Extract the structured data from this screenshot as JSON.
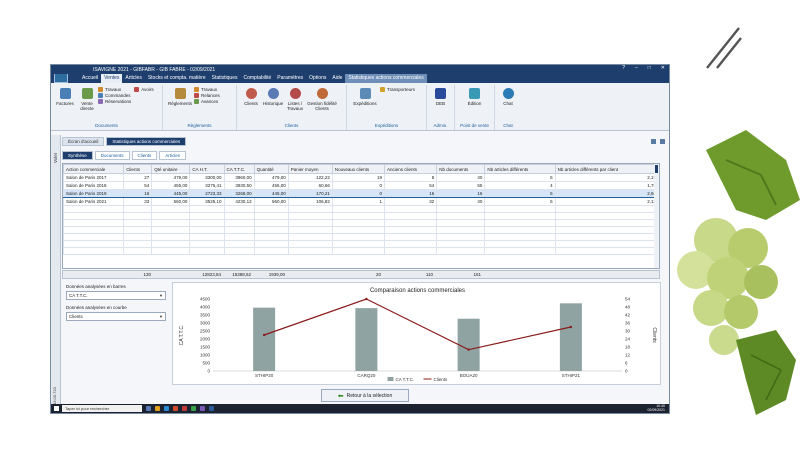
{
  "window": {
    "title": "ISAVIGNE 2021 - GIBFABR - GIB FABRE - 02/09/2021",
    "controls": [
      "?",
      "–",
      "□",
      "✕"
    ]
  },
  "menu": [
    "Accueil",
    "Ventes",
    "Articles",
    "Stocks et compta. matière",
    "Statistiques",
    "Comptabilité",
    "Paramètres",
    "Options",
    "Aide",
    "Statistiques actions commerciales"
  ],
  "ribbon": {
    "documents": {
      "factures": "Factures",
      "vente_directe": "Vente directe",
      "travaux": "Travaux",
      "commandes": "Commandes",
      "reservations": "Réservations",
      "avoirs": "Avoirs",
      "group": "Documents"
    },
    "reglements": {
      "reglements": "Règlements",
      "travaux": "Travaux",
      "relances": "Relances",
      "avances": "Avances",
      "group": "Règlements"
    },
    "clients": {
      "clients": "Clients",
      "historique": "Historique",
      "listes": "Listes / Travaux",
      "gestion": "Gestion fidélité Clients",
      "group": "Clients"
    },
    "expeditions": {
      "expeditions": "Expéditions",
      "transporteurs": "Transporteurs",
      "group": "Expéditions"
    },
    "admin": {
      "deb": "DEB",
      "group": "Admin."
    },
    "pdv": {
      "edition": "Édition",
      "group": "Point de vente"
    },
    "chat": {
      "chat": "Chat",
      "group": "Chat"
    }
  },
  "left_bar": {
    "label": "Volet",
    "version": "13.03.720"
  },
  "tabs": [
    "Écran d'accueil",
    "Statistiques actions commerciales"
  ],
  "subtabs": [
    "Synthèse",
    "Documents",
    "Clients",
    "Articles"
  ],
  "grid": {
    "headers": [
      "Action commerciale",
      "Clients",
      "Qté unitaire",
      "CA H.T.",
      "CA T.T.C.",
      "Quantité",
      "Panier moyen",
      "Nouveaux clients",
      "Anciens clients",
      "Nb documents",
      "Nb articles différents",
      "Nb articles différents par client"
    ],
    "rows": [
      [
        "Salon de Paris 2017",
        "27",
        "479,00",
        "3300,00",
        "3960,00",
        "479,00",
        "122,22",
        "19",
        "8",
        "40",
        "5",
        "2,19"
      ],
      [
        "Salon de Paris 2018",
        "54",
        "455,00",
        "3275,41",
        "3930,50",
        "455,00",
        "60,66",
        "0",
        "54",
        "55",
        "4",
        "1,78"
      ],
      [
        "Salon de Paris 2019",
        "16",
        "445,00",
        "2723,33",
        "3268,00",
        "445,00",
        "170,21",
        "0",
        "16",
        "16",
        "5",
        "2,94"
      ],
      [
        "Salon de Paris 2021",
        "33",
        "560,00",
        "3525,10",
        "4230,12",
        "560,00",
        "106,82",
        "1",
        "32",
        "40",
        "5",
        "2,12"
      ]
    ],
    "totals": {
      "clients": "130",
      "ca_ht": "12823,84",
      "ca_ttc": "15388,62",
      "quantite": "1939,00",
      "nouveaux": "20",
      "anciens": "110",
      "nb_docs": "151"
    }
  },
  "left_panel": {
    "bars_label": "Données analysées en barres",
    "bars_value": "CA T.T.C.",
    "curve_label": "Données analysées en courbe",
    "curve_value": "Clients"
  },
  "chart_data": {
    "type": "bar",
    "title": "Comparaison actions commerciales",
    "categories": [
      "STHIP20",
      "CARQ20",
      "BOUA20",
      "STHIP21"
    ],
    "series": [
      {
        "name": "CA T.T.C.",
        "type": "bar",
        "values": [
          3960,
          3930.5,
          3268,
          4230.12
        ],
        "color": "#8fa3a3"
      },
      {
        "name": "Clients",
        "type": "line",
        "values": [
          27,
          54,
          16,
          33
        ],
        "color": "#8b1a1a"
      }
    ],
    "ylabel": "CA T.T.C.",
    "y2label": "Clients",
    "ylim": [
      0,
      4500
    ],
    "y2lim": [
      0,
      54
    ],
    "yticks": [
      0,
      500,
      1000,
      1500,
      2000,
      2500,
      3000,
      3500,
      4000,
      4500
    ],
    "y2ticks": [
      0,
      6,
      12,
      18,
      24,
      30,
      36,
      42,
      48,
      54
    ],
    "legend": "bottom"
  },
  "retour_button": "Retour à la sélection",
  "taskbar": {
    "search": "Taper ici pour rechercher",
    "time": "10:40",
    "date": "02/09/2021"
  },
  "colors": {
    "titlebar": "#1e3f6e",
    "accent": "#1e5fa0"
  }
}
